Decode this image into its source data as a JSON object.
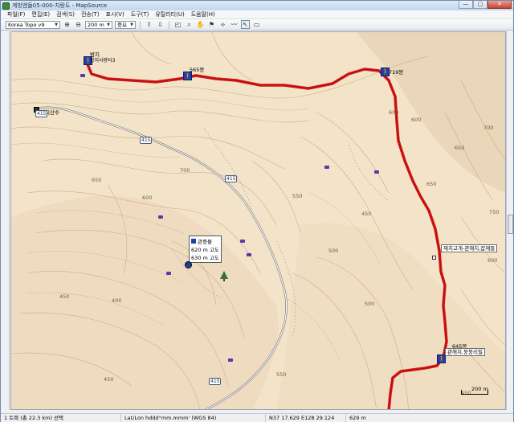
{
  "window": {
    "title": "계방엔돌05-000-치랑도 - MapSource",
    "min_glyph": "—",
    "max_glyph": "▢",
    "close_glyph": "✕"
  },
  "menu": [
    "파일(F)",
    "편집(E)",
    "검색(S)",
    "전송(T)",
    "표시(V)",
    "도구(T)",
    "유틸리티(U)",
    "도움말(H)"
  ],
  "toolbar": {
    "map_product": "Korea Topo v9",
    "zoom_level": "200 m",
    "detail_level": "중요"
  },
  "map": {
    "route_color": "#cc1111",
    "peaks": [
      {
        "label": "밤지",
        "name": "peak-bamji"
      },
      {
        "label": "565봉",
        "name": "peak-565"
      },
      {
        "label": "719봉",
        "name": "peak-719"
      },
      {
        "label": "645봉",
        "name": "peak-645"
      }
    ],
    "places": [
      {
        "label": "방치사랑터3",
        "name": "place-bangchi3"
      },
      {
        "label": "밤치산수",
        "name": "place-bamchisansu"
      },
      {
        "label": "재치고개-관해치,잡재들",
        "name": "place-jaechi-pass"
      },
      {
        "label": "관해치,뭉뭉리필",
        "name": "place-gwanhaechi"
      }
    ],
    "roads": [
      "415",
      "415",
      "415",
      "415"
    ],
    "elevations": [
      "600",
      "650",
      "700",
      "550",
      "500",
      "450",
      "400",
      "600",
      "650",
      "700",
      "450",
      "600",
      "450",
      "750",
      "650",
      "500",
      "550",
      "600",
      "450"
    ],
    "popup": {
      "title": "관중물",
      "rows": [
        "620 m 고도",
        "630 m 고도"
      ]
    },
    "scale": "200 m"
  },
  "status": {
    "track": "1 트랙 (총 22.3 km) 선택",
    "format": "Lat/Lon hddd°mm.mmm' (WGS 84)",
    "coords": "N37 17.629 E128 29.124",
    "elevation": "629 m"
  }
}
